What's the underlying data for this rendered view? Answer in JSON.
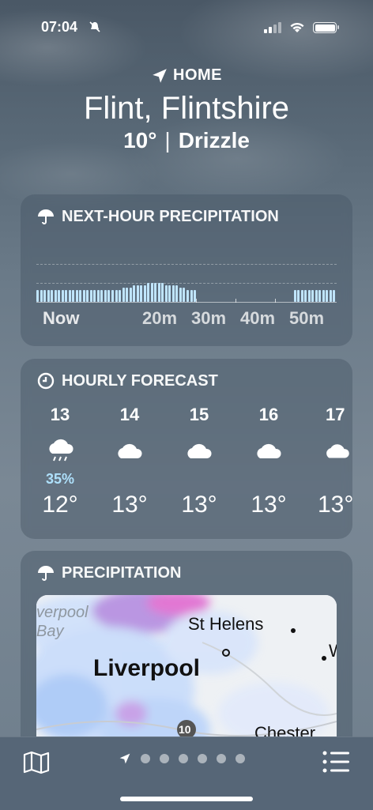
{
  "status": {
    "time": "07:04"
  },
  "location": {
    "home_label": "HOME",
    "city": "Flint, Flintshire",
    "temp": "10°",
    "condition": "Drizzle"
  },
  "next_hour": {
    "title": "NEXT-HOUR PRECIPITATION",
    "labels": [
      "Now",
      "20m",
      "30m",
      "40m",
      "50m"
    ],
    "intensity": [
      3,
      3,
      3,
      3,
      3,
      3,
      3,
      3,
      3,
      3,
      3,
      3,
      3,
      3,
      3,
      3,
      3,
      3,
      3,
      3,
      3,
      3,
      3,
      3,
      4,
      4,
      4,
      5,
      5,
      5,
      5,
      6,
      6,
      6,
      6,
      6,
      5,
      5,
      5,
      5,
      4,
      4,
      3,
      3,
      3,
      0,
      0,
      0,
      0,
      0,
      0,
      0,
      0,
      0,
      0,
      0,
      0,
      0,
      0,
      0,
      0,
      0,
      0,
      0,
      0,
      0,
      0,
      0,
      0,
      0,
      0,
      0,
      3,
      3,
      3,
      3,
      3,
      3,
      3,
      3,
      3,
      3,
      3,
      3
    ],
    "bar_color": "#bfe4fb"
  },
  "hourly": {
    "title": "HOURLY FORECAST",
    "items": [
      {
        "hour": "13",
        "icon": "cloud-rain-icon",
        "precip": "35%",
        "temp": "12°"
      },
      {
        "hour": "14",
        "icon": "cloud-icon",
        "precip": "",
        "temp": "13°"
      },
      {
        "hour": "15",
        "icon": "cloud-icon",
        "precip": "",
        "temp": "13°"
      },
      {
        "hour": "16",
        "icon": "cloud-icon",
        "precip": "",
        "temp": "13°"
      },
      {
        "hour": "17",
        "icon": "cloud-icon",
        "precip": "",
        "temp": "13°"
      }
    ]
  },
  "precip_map": {
    "title": "PRECIPITATION",
    "labels": {
      "bay": "verpool\nBay",
      "liverpool": "Liverpool",
      "st_helens": "St Helens",
      "w": "W",
      "chester": "Chester",
      "road": "10"
    }
  },
  "page_dots": 6
}
